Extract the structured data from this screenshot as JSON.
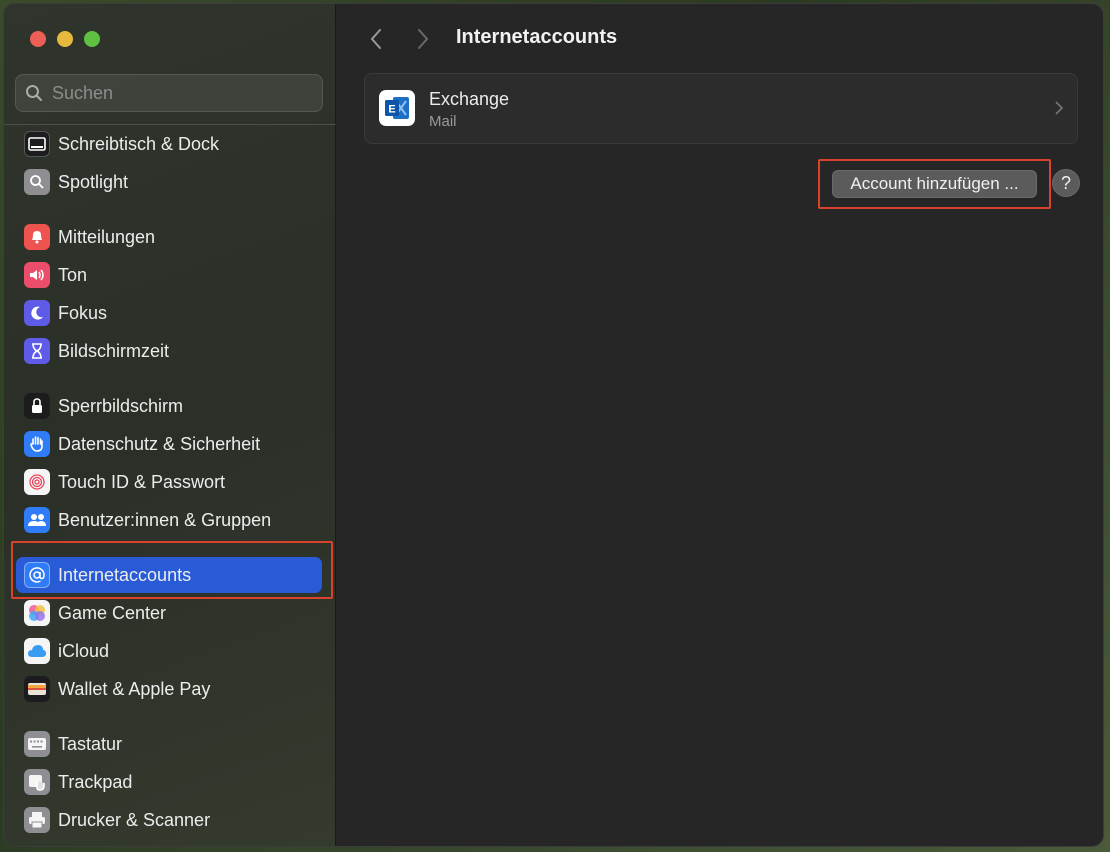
{
  "search": {
    "placeholder": "Suchen"
  },
  "sidebar": {
    "items": [
      {
        "id": "schreibtisch-dock",
        "label": "Schreibtisch & Dock",
        "icon": "dock-icon",
        "color": "#1c1c1e"
      },
      {
        "id": "spotlight",
        "label": "Spotlight",
        "icon": "spotlight-icon",
        "color": "#8e8e93"
      },
      {
        "id": "mitteilungen",
        "label": "Mitteilungen",
        "icon": "bell-icon",
        "color": "#ef5350"
      },
      {
        "id": "ton",
        "label": "Ton",
        "icon": "speaker-icon",
        "color": "#ec4d6a"
      },
      {
        "id": "fokus",
        "label": "Fokus",
        "icon": "moon-icon",
        "color": "#5e5ce6"
      },
      {
        "id": "bildschirmzeit",
        "label": "Bildschirmzeit",
        "icon": "hourglass-icon",
        "color": "#5e5ce6"
      },
      {
        "id": "sperrbildschirm",
        "label": "Sperrbildschirm",
        "icon": "lock-icon",
        "color": "#1c1c1e"
      },
      {
        "id": "datenschutz",
        "label": "Datenschutz & Sicherheit",
        "icon": "hand-icon",
        "color": "#2f7cf6"
      },
      {
        "id": "touch-id",
        "label": "Touch ID & Passwort",
        "icon": "fingerprint-icon",
        "color": "#f5f5f5"
      },
      {
        "id": "benutzer",
        "label": "Benutzer:innen & Gruppen",
        "icon": "users-icon",
        "color": "#2f7cf6"
      },
      {
        "id": "internetaccounts",
        "label": "Internetaccounts",
        "icon": "at-icon",
        "color": "#2f7cf6",
        "active": true
      },
      {
        "id": "game-center",
        "label": "Game Center",
        "icon": "game-center-icon",
        "color": "#f5f5f5"
      },
      {
        "id": "icloud",
        "label": "iCloud",
        "icon": "cloud-icon",
        "color": "#f5f5f5"
      },
      {
        "id": "wallet",
        "label": "Wallet & Apple Pay",
        "icon": "wallet-icon",
        "color": "#1c1c1e"
      },
      {
        "id": "tastatur",
        "label": "Tastatur",
        "icon": "keyboard-icon",
        "color": "#8e8e93"
      },
      {
        "id": "trackpad",
        "label": "Trackpad",
        "icon": "trackpad-icon",
        "color": "#8e8e93"
      },
      {
        "id": "drucker",
        "label": "Drucker & Scanner",
        "icon": "printer-icon",
        "color": "#8e8e93"
      }
    ]
  },
  "main": {
    "title": "Internetaccounts",
    "accounts": [
      {
        "name": "Exchange",
        "detail": "Mail",
        "icon": "exchange-icon"
      }
    ],
    "add_button": "Account hinzufügen ...",
    "help": "?"
  },
  "colors": {
    "accent": "#2a5bd7",
    "highlight": "#d9432c"
  }
}
